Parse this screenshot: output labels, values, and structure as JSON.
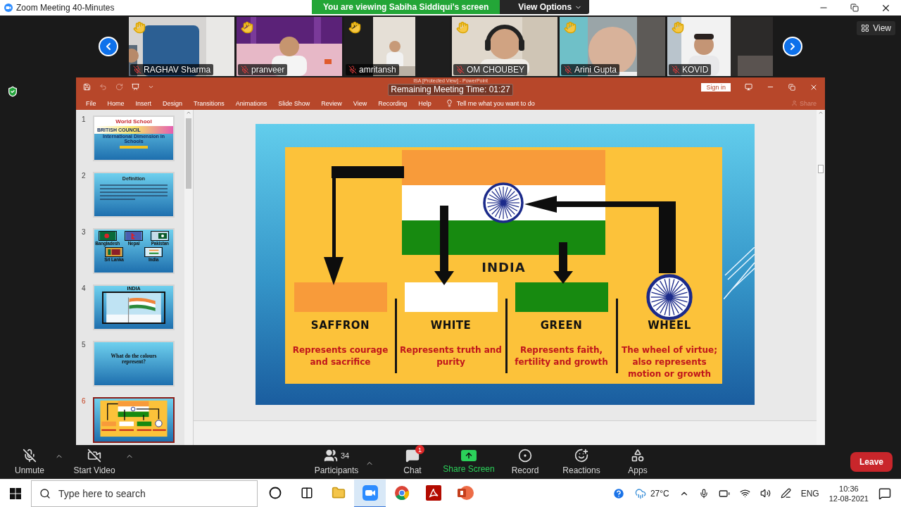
{
  "window": {
    "title": "Zoom Meeting 40-Minutes"
  },
  "share_banner": {
    "text": "You are viewing Sabiha Siddiqui's screen",
    "options_label": "View Options"
  },
  "gallery": {
    "view_label": "View",
    "participants": [
      {
        "name": "RAGHAV Sharma",
        "hand_raised": true,
        "muted": true
      },
      {
        "name": "pranveer",
        "hand_raised": true,
        "muted": true
      },
      {
        "name": "amritansh",
        "hand_raised": true,
        "muted": true
      },
      {
        "name": "OM CHOUBEY",
        "hand_raised": true,
        "muted": true
      },
      {
        "name": "Arini Gupta",
        "hand_raised": true,
        "muted": true
      },
      {
        "name": "KOVID",
        "hand_raised": true,
        "muted": true
      }
    ]
  },
  "presentation": {
    "app_title": "ISA [Protected View]  -  PowerPoint",
    "timer": "Remaining Meeting Time: 01:27",
    "sign_in": "Sign in",
    "menu": [
      "File",
      "Home",
      "Insert",
      "Design",
      "Transitions",
      "Animations",
      "Slide Show",
      "Review",
      "View",
      "Recording",
      "Help"
    ],
    "tell_me": "Tell me what you want to do",
    "share": "Share",
    "thumbnails": [
      {
        "number": "1",
        "kind": "title",
        "selected": false,
        "lines": [
          "World School",
          "BRITISH COUNCIL",
          "International Dimension in Schools"
        ]
      },
      {
        "number": "2",
        "kind": "text",
        "selected": false,
        "lines": [
          "Definition"
        ]
      },
      {
        "number": "3",
        "kind": "flags",
        "selected": false,
        "lines": [
          "Bangladesh",
          "Nepal",
          "Pakistan",
          "Sri Lanka",
          "India"
        ]
      },
      {
        "number": "4",
        "selected": false,
        "lines": [
          "INDIA"
        ]
      },
      {
        "number": "5",
        "kind": "question",
        "selected": false,
        "lines": [
          "What do the colours represent?"
        ]
      },
      {
        "number": "6",
        "kind": "diagram",
        "selected": true
      }
    ],
    "slide": {
      "title": "INDIA",
      "columns": [
        {
          "kind": "swatch",
          "color": "#f89b3a",
          "name": "SAFFRON",
          "description": "Represents courage and sacrifice"
        },
        {
          "kind": "swatch",
          "color": "#ffffff",
          "name": "WHITE",
          "description": "Represents truth and purity"
        },
        {
          "kind": "swatch",
          "color": "#178a10",
          "name": "GREEN",
          "description": "Represents faith, fertility and growth"
        },
        {
          "kind": "wheel",
          "name": "WHEEL",
          "description": "The wheel of virtue; also represents motion or growth"
        }
      ]
    }
  },
  "toolbar": {
    "left": [
      {
        "kind": "mic",
        "label": "Unmute",
        "off": true
      },
      {
        "kind": "video",
        "label": "Start Video",
        "off": true
      }
    ],
    "center": [
      {
        "kind": "participants",
        "label": "Participants",
        "count": "34"
      },
      {
        "kind": "chat",
        "label": "Chat",
        "badge": "1"
      },
      {
        "kind": "share",
        "label": "Share Screen"
      },
      {
        "kind": "record",
        "label": "Record"
      },
      {
        "kind": "reactions",
        "label": "Reactions"
      },
      {
        "kind": "apps",
        "label": "Apps"
      }
    ],
    "leave": "Leave"
  },
  "taskbar": {
    "search_placeholder": "Type here to search",
    "apps": [
      {
        "kind": "assistant",
        "active": false
      },
      {
        "kind": "taskview",
        "active": false
      },
      {
        "kind": "folder",
        "active": false
      },
      {
        "kind": "meeting",
        "active": true
      },
      {
        "kind": "browser",
        "active": false
      },
      {
        "kind": "pdf",
        "active": false
      },
      {
        "kind": "slides",
        "active": false
      }
    ],
    "temperature": "27°C",
    "language": "ENG",
    "time": "10:36",
    "date": "12-08-2021"
  }
}
